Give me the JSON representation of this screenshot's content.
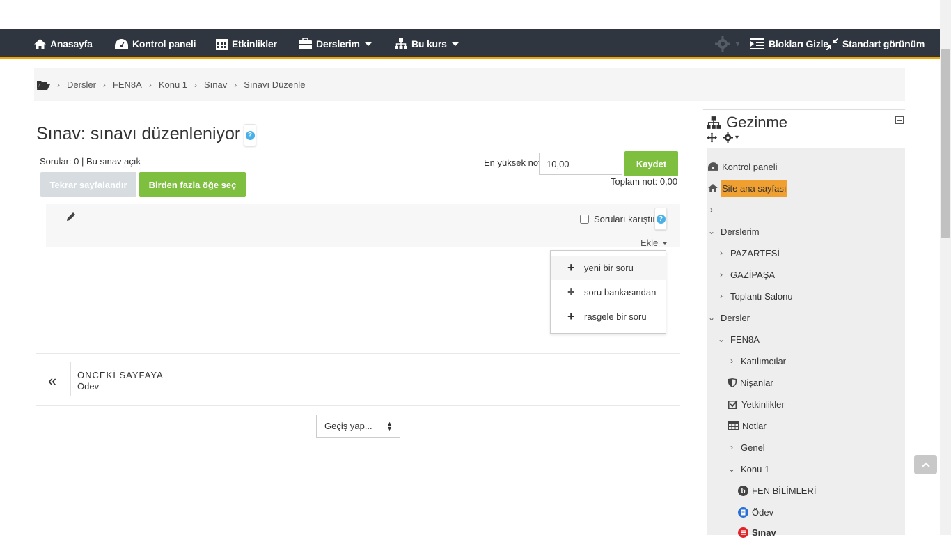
{
  "navbar": {
    "home": "Anasayfa",
    "dashboard": "Kontrol paneli",
    "events": "Etkinlikler",
    "mycourses": "Derslerim",
    "thiscourse": "Bu kurs",
    "hide_blocks": "Blokları Gizle",
    "standard_view": "Standart görünüm"
  },
  "breadcrumb": [
    "Dersler",
    "FEN8A",
    "Konu 1",
    "Sınav",
    "Sınavı Düzenle"
  ],
  "page": {
    "title": "Sınav: sınavı düzenleniyor",
    "questions_info": "Sorular: 0 | Bu sınav açık",
    "repaginate_button": "Tekrar sayfalandır",
    "select_multiple_button": "Birden fazla öğe seç",
    "max_grade_label": "En yüksek not",
    "max_grade_value": "10,00",
    "save_button": "Kaydet",
    "total_grade": "Toplam not: 0,00",
    "shuffle_label": "Soruları karıştır",
    "add_label": "Ekle"
  },
  "add_menu": {
    "items": [
      "yeni bir soru",
      "soru bankasından",
      "rasgele bir soru"
    ]
  },
  "prev_nav": {
    "label": "ÖNCEKİ SAYFAYA",
    "sub": "Ödev"
  },
  "jump": {
    "placeholder": "Geçiş yap..."
  },
  "nav_block": {
    "title": "Gezinme",
    "dashboard": "Kontrol paneli",
    "site_home": "Site ana sayfası",
    "mycourses": "Derslerim",
    "pazartesi": "PAZARTESİ",
    "gazipasa": "GAZİPAŞA",
    "toplanti": "Toplantı Salonu",
    "dersler": "Dersler",
    "fen8a": "FEN8A",
    "participants": "Katılımcılar",
    "badges": "Nişanlar",
    "competencies": "Yetkinlikler",
    "grades": "Notlar",
    "general": "Genel",
    "konu1": "Konu 1",
    "fen_bilimleri": "FEN BİLİMLERİ",
    "odev": "Ödev",
    "sinav": "Sınav"
  },
  "colors": {
    "navbar_bg": "#2f3640",
    "accent": "#f0a500",
    "green": "#7fbf3f"
  }
}
